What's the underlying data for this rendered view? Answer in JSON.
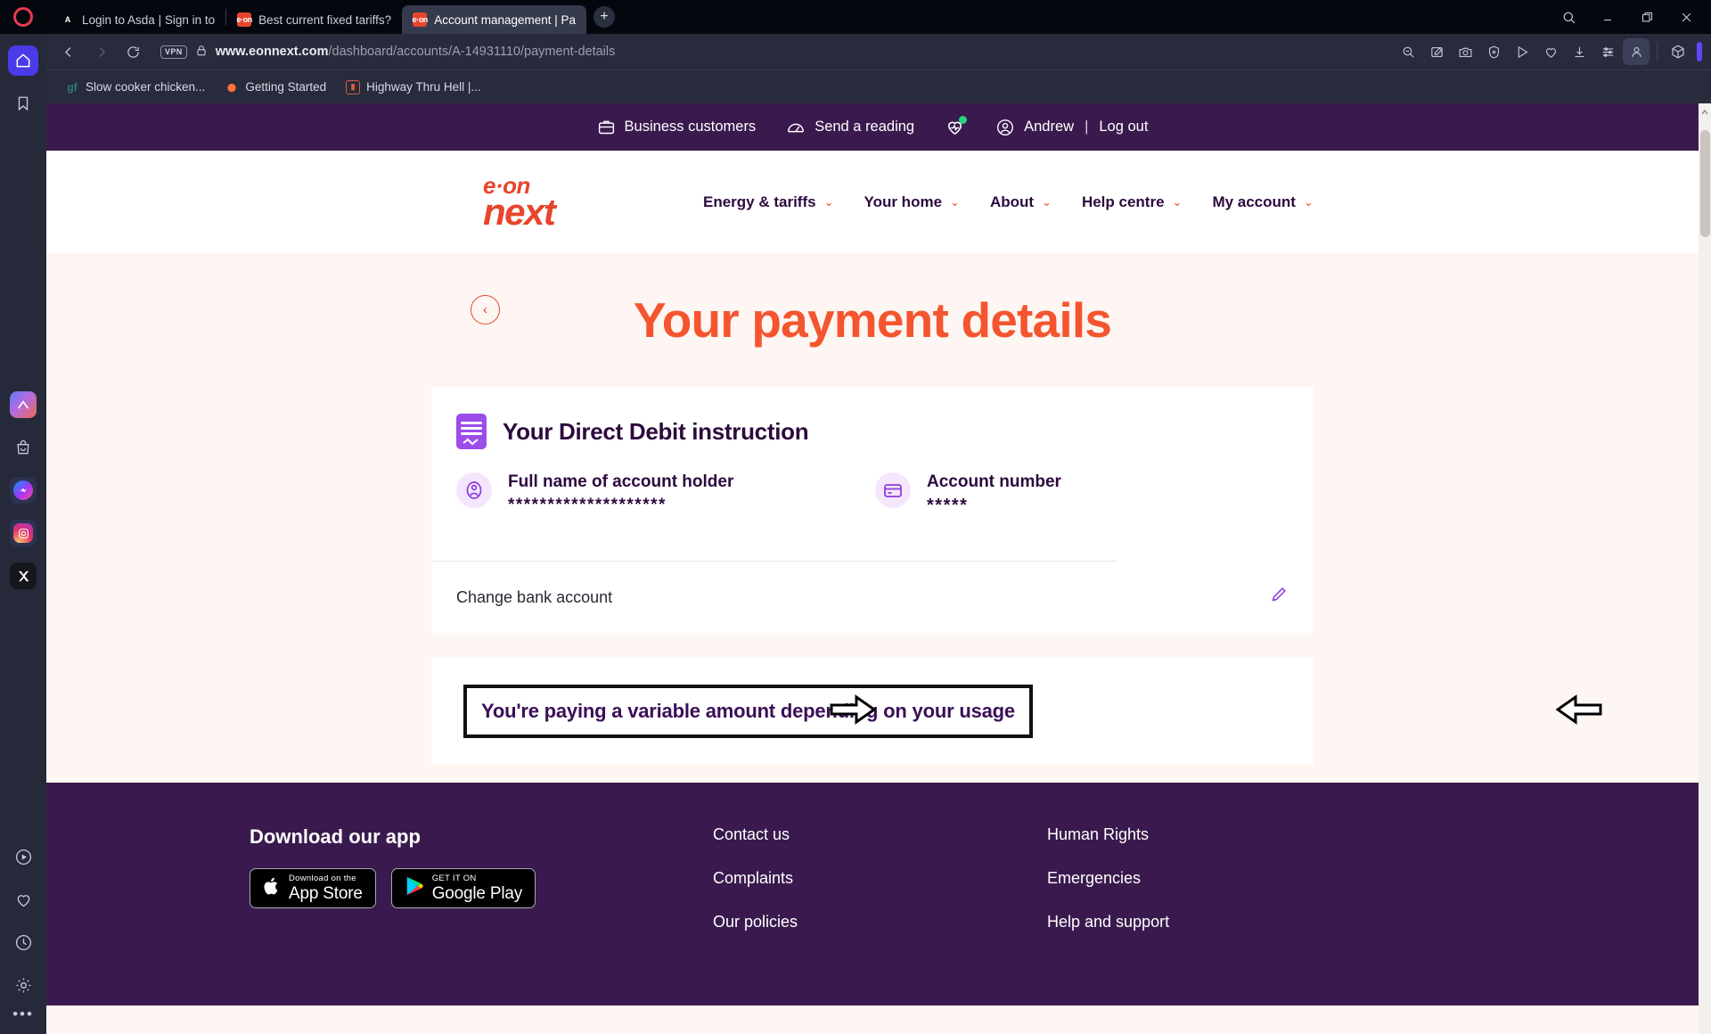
{
  "browser": {
    "app_name": "Opera",
    "tabs": [
      {
        "title": "Login to Asda | Sign in to",
        "favicon": "asda-icon",
        "active": false
      },
      {
        "title": "Best current fixed tariffs?",
        "favicon": "eonnext-icon",
        "active": false
      },
      {
        "title": "Account management | Pa",
        "favicon": "eonnext-icon",
        "active": true
      }
    ],
    "new_tab_label": "+",
    "window_controls": {
      "search": "search-icon",
      "minimize": "minimize-icon",
      "maximize": "maximize-icon",
      "close": "close-icon"
    },
    "nav": {
      "back": "back-arrow-icon",
      "forward": "forward-arrow-icon",
      "reload": "reload-icon"
    },
    "address": {
      "vpn_badge": "VPN",
      "lock": "padlock-icon",
      "domain": "www.eonnext.com",
      "path": "/dashboard/accounts/A-14931110/payment-details"
    },
    "toolbar_icons": [
      "zoom-out-icon",
      "snapshot-edit-icon",
      "camera-icon",
      "shield-block-icon",
      "send-icon",
      "heart-icon",
      "download-icon",
      "settings-sliders-icon",
      "profile-icon",
      "cube-icon"
    ],
    "bookmarks": [
      {
        "label": "Slow cooker chicken...",
        "favicon": "goodfood-icon"
      },
      {
        "label": "Getting Started",
        "favicon": "firefox-icon"
      },
      {
        "label": "Highway Thru Hell |...",
        "favicon": "video-icon"
      }
    ],
    "sidebar_icons": [
      "opera-logo-icon",
      "home-icon",
      "bookmark-icon",
      "nimble-icon",
      "shopping-bag-icon",
      "messenger-icon",
      "instagram-icon",
      "x-twitter-icon",
      "player-icon",
      "favourites-heart-icon",
      "history-clock-icon",
      "gear-icon",
      "more-dots-icon"
    ]
  },
  "site": {
    "utilbar": {
      "business": "Business customers",
      "business_icon": "briefcase-icon",
      "reading": "Send a reading",
      "reading_icon": "meter-gauge-icon",
      "loyalty_icon": "heart-pulse-icon",
      "account_icon": "user-circle-icon",
      "user": "Andrew",
      "separator": "|",
      "logout": "Log out"
    },
    "logo": {
      "top": "e·on",
      "bottom": "next"
    },
    "nav": [
      {
        "label": "Energy & tariffs",
        "caret": "chevron-down-icon"
      },
      {
        "label": "Your home",
        "caret": "chevron-down-icon"
      },
      {
        "label": "About",
        "caret": "chevron-down-icon"
      },
      {
        "label": "Help centre",
        "caret": "chevron-down-icon"
      },
      {
        "label": "My account",
        "caret": "chevron-down-icon"
      }
    ],
    "page_title": "Your payment details",
    "back_icon": "back-chevron-circle-icon",
    "dd_card": {
      "heading": "Your Direct Debit instruction",
      "heading_icon": "direct-debit-document-icon",
      "fields": [
        {
          "icon": "person-circle-icon",
          "label": "Full name of account holder",
          "value": "********************"
        },
        {
          "icon": "credit-card-icon",
          "label": "Account number",
          "value": "*****"
        }
      ],
      "row_label": "Change bank account",
      "row_icon": "pencil-edit-icon"
    },
    "payment_notice": {
      "text": "You're paying a variable amount depending on your usage",
      "left_arrow": "annotation-arrow-right-icon",
      "right_arrow": "annotation-arrow-left-icon"
    },
    "footer": {
      "app_heading": "Download our app",
      "badges": [
        {
          "small": "Download on the",
          "big": "App Store",
          "icon": "apple-icon"
        },
        {
          "small": "GET IT ON",
          "big": "Google Play",
          "icon": "google-play-icon"
        }
      ],
      "col1": [
        "Contact us",
        "Complaints",
        "Our policies"
      ],
      "col2": [
        "Human Rights",
        "Emergencies",
        "Help and support"
      ]
    }
  },
  "colors": {
    "brand_orange": "#f4552f",
    "brand_purple": "#3a1a4e",
    "accent_violet": "#8e3ae0",
    "page_bg": "#fdf6f2",
    "chrome_bg": "#272b3c"
  }
}
